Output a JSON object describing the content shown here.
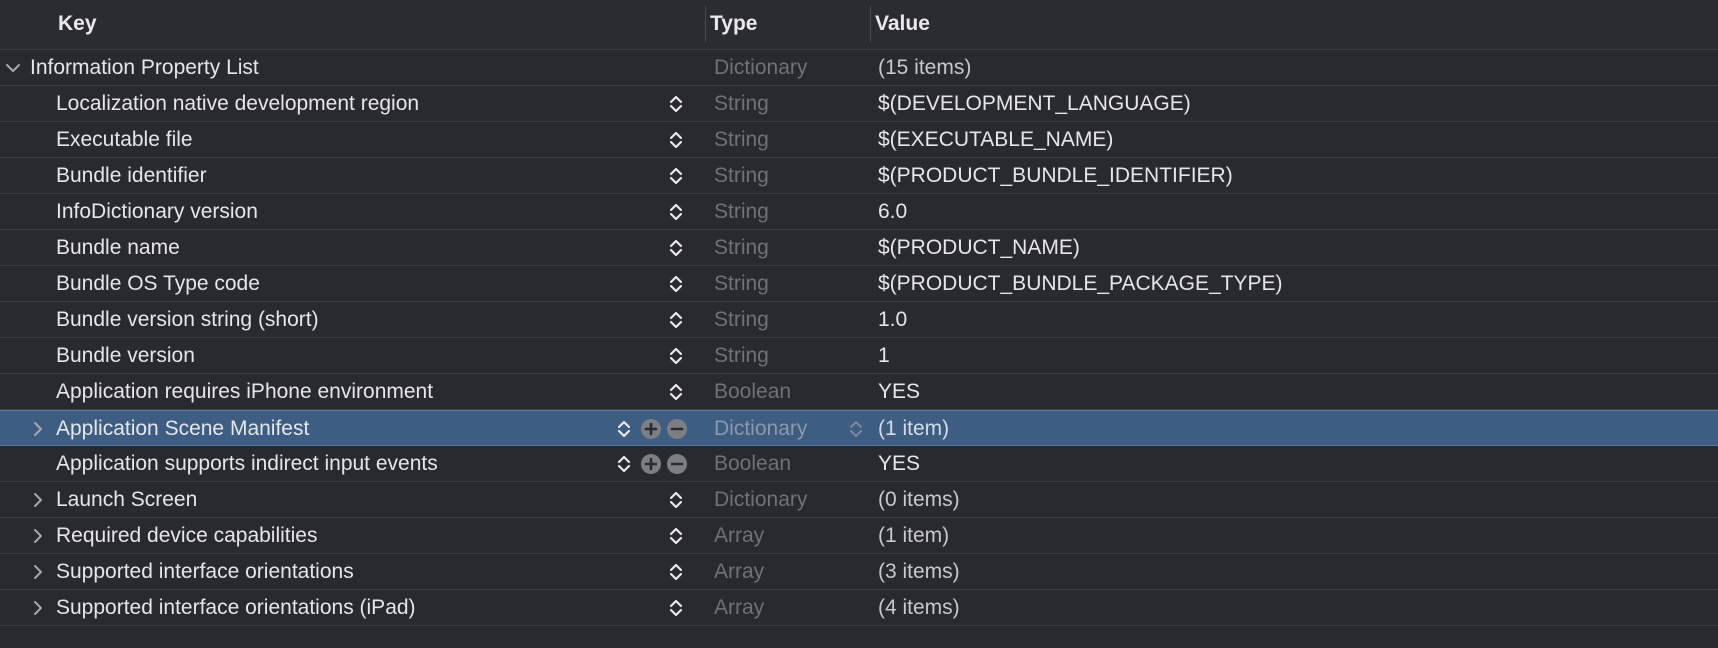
{
  "header": {
    "key": "Key",
    "type": "Type",
    "value": "Value"
  },
  "colors": {
    "background": "#292a2f",
    "selection": "#3e5d82",
    "type_text": "#707176",
    "text": "#e6e6e8"
  },
  "rows": [
    {
      "key": "Information Property List",
      "type": "Dictionary",
      "value": "(15 items)",
      "disclosure": "chevron-down-icon",
      "level": 0
    },
    {
      "key": "Localization native development region",
      "type": "String",
      "value": "$(DEVELOPMENT_LANGUAGE)",
      "level": 1
    },
    {
      "key": "Executable file",
      "type": "String",
      "value": "$(EXECUTABLE_NAME)",
      "level": 1
    },
    {
      "key": "Bundle identifier",
      "type": "String",
      "value": "$(PRODUCT_BUNDLE_IDENTIFIER)",
      "level": 1
    },
    {
      "key": "InfoDictionary version",
      "type": "String",
      "value": "6.0",
      "level": 1
    },
    {
      "key": "Bundle name",
      "type": "String",
      "value": "$(PRODUCT_NAME)",
      "level": 1
    },
    {
      "key": "Bundle OS Type code",
      "type": "String",
      "value": "$(PRODUCT_BUNDLE_PACKAGE_TYPE)",
      "level": 1
    },
    {
      "key": "Bundle version string (short)",
      "type": "String",
      "value": "1.0",
      "level": 1
    },
    {
      "key": "Bundle version",
      "type": "String",
      "value": "1",
      "level": 1
    },
    {
      "key": "Application requires iPhone environment",
      "type": "Boolean",
      "value": "YES",
      "level": 1
    },
    {
      "key": "Application Scene Manifest",
      "type": "Dictionary",
      "value": "(1 item)",
      "disclosure": "chevron-right-icon",
      "level": 1,
      "selected": true
    },
    {
      "key": "Application supports indirect input events",
      "type": "Boolean",
      "value": "YES",
      "level": 1,
      "hover": true
    },
    {
      "key": "Launch Screen",
      "type": "Dictionary",
      "value": "(0 items)",
      "disclosure": "chevron-right-icon",
      "level": 1
    },
    {
      "key": "Required device capabilities",
      "type": "Array",
      "value": "(1 item)",
      "disclosure": "chevron-right-icon",
      "level": 1
    },
    {
      "key": "Supported interface orientations",
      "type": "Array",
      "value": "(3 items)",
      "disclosure": "chevron-right-icon",
      "level": 1
    },
    {
      "key": "Supported interface orientations (iPad)",
      "type": "Array",
      "value": "(4 items)",
      "disclosure": "chevron-right-icon",
      "level": 1
    }
  ]
}
